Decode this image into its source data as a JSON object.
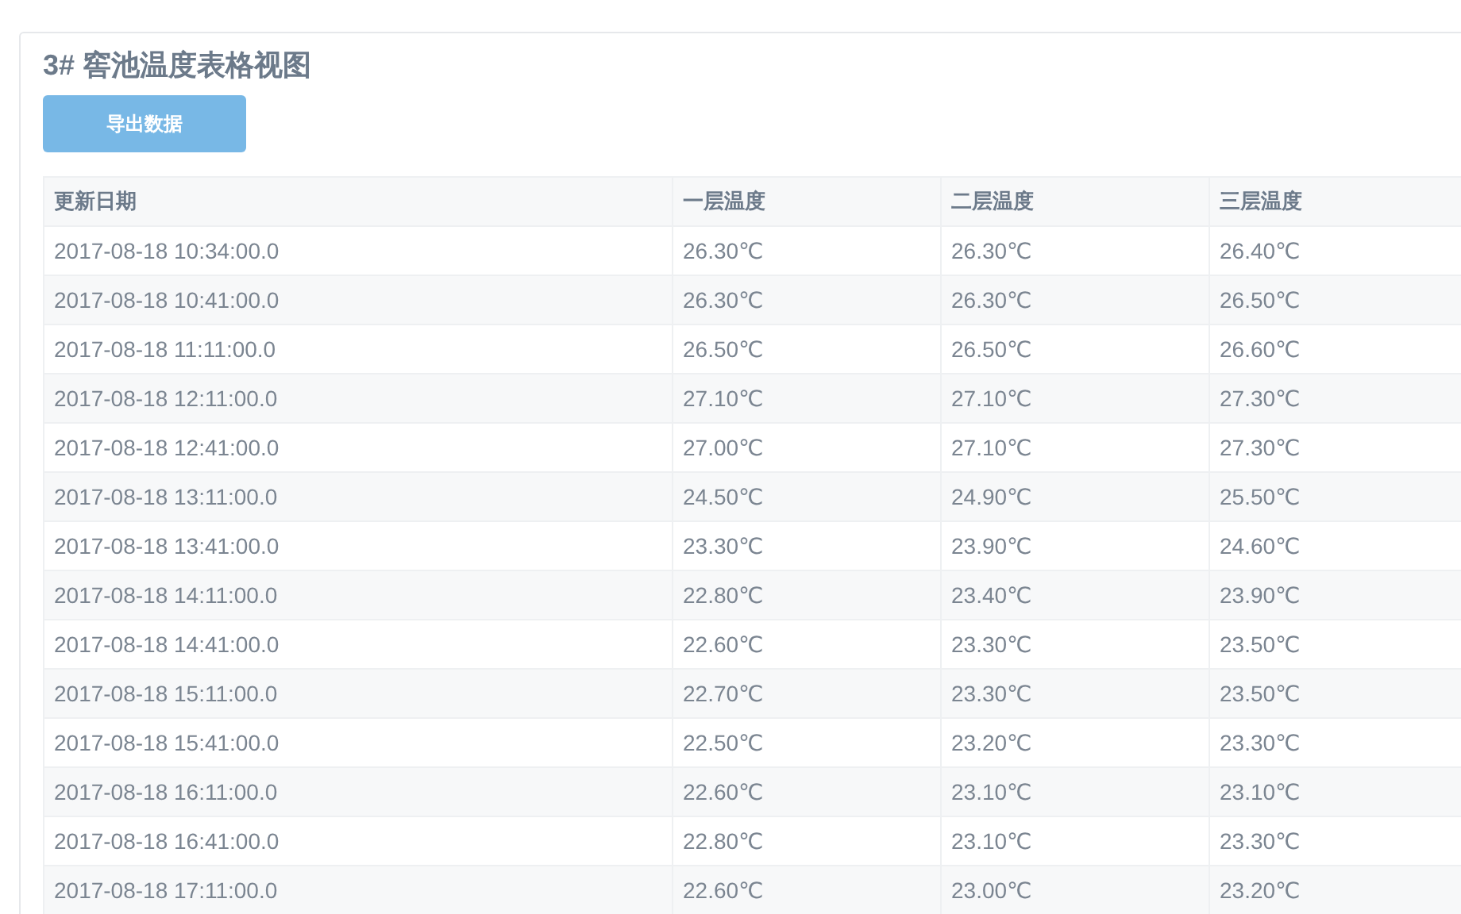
{
  "title": "3# 窖池温度表格视图",
  "export_button": "导出数据",
  "table": {
    "columns": [
      "更新日期",
      "一层温度",
      "二层温度",
      "三层温度"
    ],
    "rows": [
      [
        "2017-08-18 10:34:00.0",
        "26.30℃",
        "26.30℃",
        "26.40℃"
      ],
      [
        "2017-08-18 10:41:00.0",
        "26.30℃",
        "26.30℃",
        "26.50℃"
      ],
      [
        "2017-08-18 11:11:00.0",
        "26.50℃",
        "26.50℃",
        "26.60℃"
      ],
      [
        "2017-08-18 12:11:00.0",
        "27.10℃",
        "27.10℃",
        "27.30℃"
      ],
      [
        "2017-08-18 12:41:00.0",
        "27.00℃",
        "27.10℃",
        "27.30℃"
      ],
      [
        "2017-08-18 13:11:00.0",
        "24.50℃",
        "24.90℃",
        "25.50℃"
      ],
      [
        "2017-08-18 13:41:00.0",
        "23.30℃",
        "23.90℃",
        "24.60℃"
      ],
      [
        "2017-08-18 14:11:00.0",
        "22.80℃",
        "23.40℃",
        "23.90℃"
      ],
      [
        "2017-08-18 14:41:00.0",
        "22.60℃",
        "23.30℃",
        "23.50℃"
      ],
      [
        "2017-08-18 15:11:00.0",
        "22.70℃",
        "23.30℃",
        "23.50℃"
      ],
      [
        "2017-08-18 15:41:00.0",
        "22.50℃",
        "23.20℃",
        "23.30℃"
      ],
      [
        "2017-08-18 16:11:00.0",
        "22.60℃",
        "23.10℃",
        "23.10℃"
      ],
      [
        "2017-08-18 16:41:00.0",
        "22.80℃",
        "23.10℃",
        "23.30℃"
      ],
      [
        "2017-08-18 17:11:00.0",
        "22.60℃",
        "23.00℃",
        "23.20℃"
      ]
    ]
  }
}
